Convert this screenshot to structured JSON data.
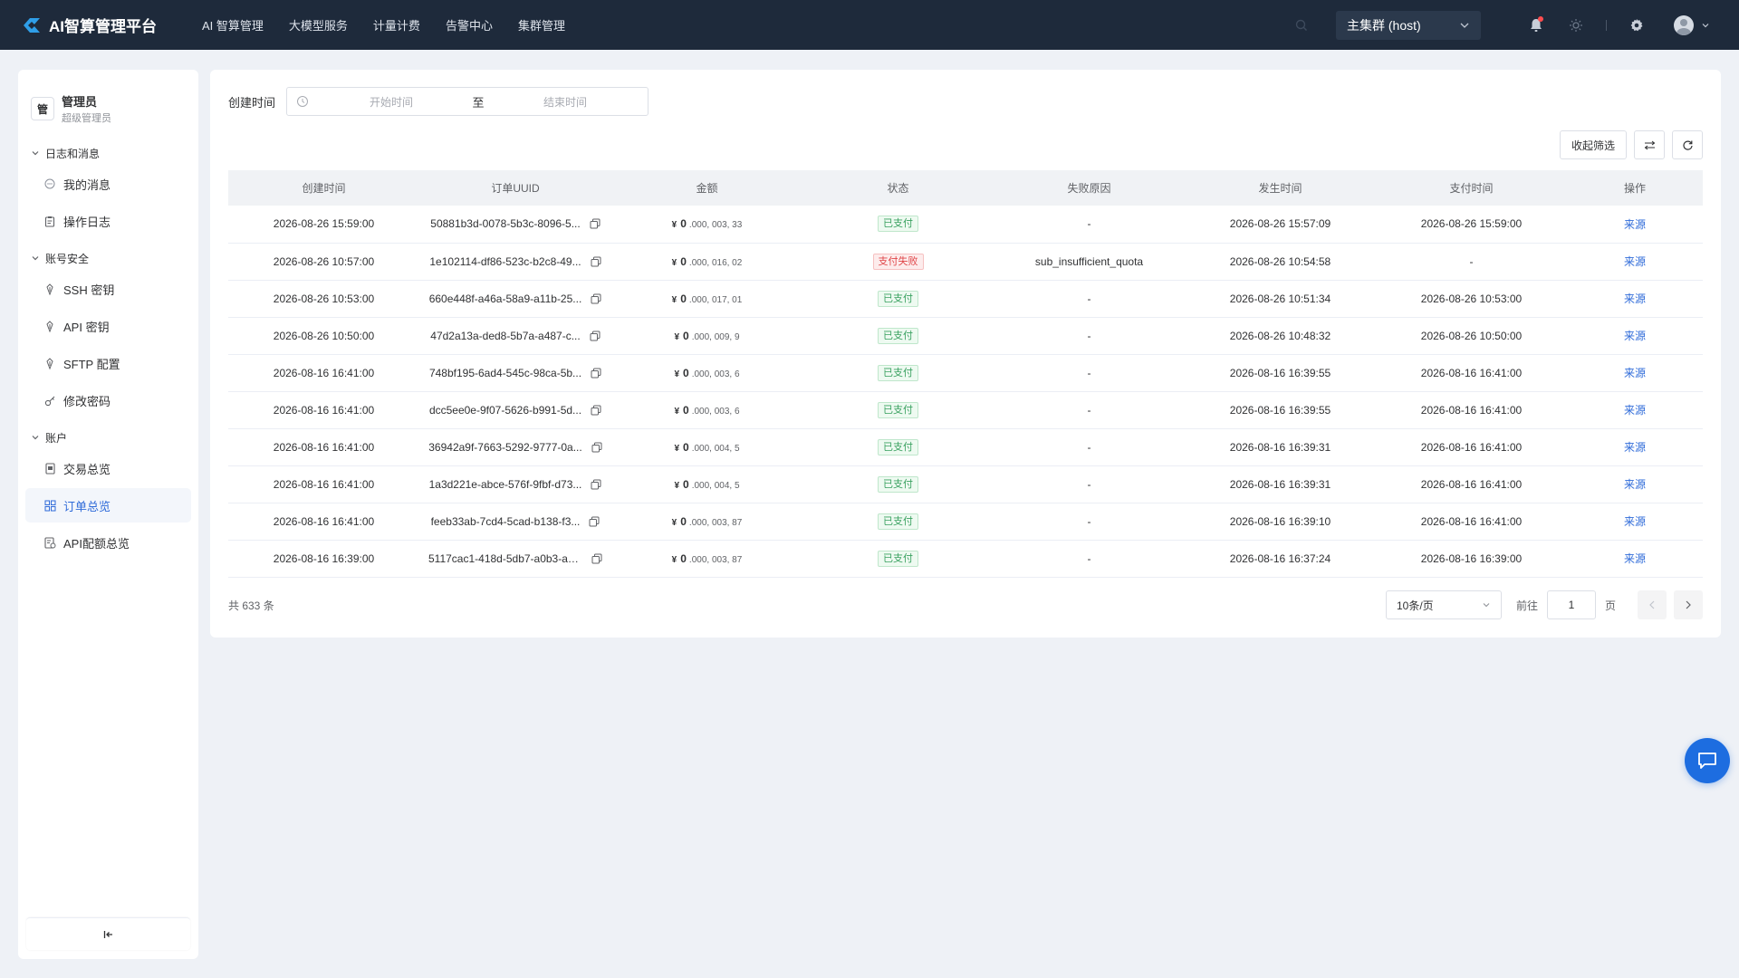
{
  "app": {
    "title": "AI智算管理平台",
    "brand_color": "#2f9ee8"
  },
  "nav": [
    {
      "label": "AI 智算管理"
    },
    {
      "label": "大模型服务"
    },
    {
      "label": "计量计费"
    },
    {
      "label": "告警中心"
    },
    {
      "label": "集群管理"
    }
  ],
  "header": {
    "cluster": "主集群 (host)"
  },
  "user": {
    "badge": "管",
    "name": "管理员",
    "role": "超级管理员"
  },
  "sidebar": {
    "groups": [
      {
        "title": "日志和消息",
        "items": [
          {
            "label": "我的消息",
            "icon": "message-icon"
          },
          {
            "label": "操作日志",
            "icon": "clipboard-icon"
          }
        ]
      },
      {
        "title": "账号安全",
        "items": [
          {
            "label": "SSH 密钥",
            "icon": "key-icon"
          },
          {
            "label": "API 密钥",
            "icon": "key-icon"
          },
          {
            "label": "SFTP 配置",
            "icon": "key-icon"
          },
          {
            "label": "修改密码",
            "icon": "password-icon"
          }
        ]
      },
      {
        "title": "账户",
        "items": [
          {
            "label": "交易总览",
            "icon": "receipt-icon"
          },
          {
            "label": "订单总览",
            "icon": "grid-icon",
            "active": true
          },
          {
            "label": "API配额总览",
            "icon": "quota-icon"
          }
        ]
      }
    ]
  },
  "filter": {
    "label": "创建时间",
    "start_placeholder": "开始时间",
    "separator": "至",
    "end_placeholder": "结束时间"
  },
  "tools": {
    "collapse_filter": "收起筛选"
  },
  "table": {
    "headers": [
      "创建时间",
      "订单UUID",
      "金额",
      "状态",
      "失败原因",
      "发生时间",
      "支付时间",
      "操作"
    ],
    "rows": [
      {
        "created": "2026-08-26 15:59:00",
        "uuid": "50881b3d-0078-5b3c-8096-5...",
        "currency": "¥",
        "amount_main": "0",
        "amount_frac": ".000, 003, 33",
        "status": "已支付",
        "status_type": "paid",
        "reason": "-",
        "occurred": "2026-08-26 15:57:09",
        "paid_at": "2026-08-26 15:59:00",
        "action": "来源"
      },
      {
        "created": "2026-08-26 10:57:00",
        "uuid": "1e102114-df86-523c-b2c8-49...",
        "currency": "¥",
        "amount_main": "0",
        "amount_frac": ".000, 016, 02",
        "status": "支付失败",
        "status_type": "failed",
        "reason": "sub_insufficient_quota",
        "occurred": "2026-08-26 10:54:58",
        "paid_at": "-",
        "action": "来源"
      },
      {
        "created": "2026-08-26 10:53:00",
        "uuid": "660e448f-a46a-58a9-a11b-25...",
        "currency": "¥",
        "amount_main": "0",
        "amount_frac": ".000, 017, 01",
        "status": "已支付",
        "status_type": "paid",
        "reason": "-",
        "occurred": "2026-08-26 10:51:34",
        "paid_at": "2026-08-26 10:53:00",
        "action": "来源"
      },
      {
        "created": "2026-08-26 10:50:00",
        "uuid": "47d2a13a-ded8-5b7a-a487-c...",
        "currency": "¥",
        "amount_main": "0",
        "amount_frac": ".000, 009, 9",
        "status": "已支付",
        "status_type": "paid",
        "reason": "-",
        "occurred": "2026-08-26 10:48:32",
        "paid_at": "2026-08-26 10:50:00",
        "action": "来源"
      },
      {
        "created": "2026-08-16 16:41:00",
        "uuid": "748bf195-6ad4-545c-98ca-5b...",
        "currency": "¥",
        "amount_main": "0",
        "amount_frac": ".000, 003, 6",
        "status": "已支付",
        "status_type": "paid",
        "reason": "-",
        "occurred": "2026-08-16 16:39:55",
        "paid_at": "2026-08-16 16:41:00",
        "action": "来源"
      },
      {
        "created": "2026-08-16 16:41:00",
        "uuid": "dcc5ee0e-9f07-5626-b991-5d...",
        "currency": "¥",
        "amount_main": "0",
        "amount_frac": ".000, 003, 6",
        "status": "已支付",
        "status_type": "paid",
        "reason": "-",
        "occurred": "2026-08-16 16:39:55",
        "paid_at": "2026-08-16 16:41:00",
        "action": "来源"
      },
      {
        "created": "2026-08-16 16:41:00",
        "uuid": "36942a9f-7663-5292-9777-0a...",
        "currency": "¥",
        "amount_main": "0",
        "amount_frac": ".000, 004, 5",
        "status": "已支付",
        "status_type": "paid",
        "reason": "-",
        "occurred": "2026-08-16 16:39:31",
        "paid_at": "2026-08-16 16:41:00",
        "action": "来源"
      },
      {
        "created": "2026-08-16 16:41:00",
        "uuid": "1a3d221e-abce-576f-9fbf-d73...",
        "currency": "¥",
        "amount_main": "0",
        "amount_frac": ".000, 004, 5",
        "status": "已支付",
        "status_type": "paid",
        "reason": "-",
        "occurred": "2026-08-16 16:39:31",
        "paid_at": "2026-08-16 16:41:00",
        "action": "来源"
      },
      {
        "created": "2026-08-16 16:41:00",
        "uuid": "feeb33ab-7cd4-5cad-b138-f3...",
        "currency": "¥",
        "amount_main": "0",
        "amount_frac": ".000, 003, 87",
        "status": "已支付",
        "status_type": "paid",
        "reason": "-",
        "occurred": "2026-08-16 16:39:10",
        "paid_at": "2026-08-16 16:41:00",
        "action": "来源"
      },
      {
        "created": "2026-08-16 16:39:00",
        "uuid": "5117cac1-418d-5db7-a0b3-a3...",
        "currency": "¥",
        "amount_main": "0",
        "amount_frac": ".000, 003, 87",
        "status": "已支付",
        "status_type": "paid",
        "reason": "-",
        "occurred": "2026-08-16 16:37:24",
        "paid_at": "2026-08-16 16:39:00",
        "action": "来源"
      }
    ]
  },
  "pagination": {
    "total_text": "共 633 条",
    "page_size": "10条/页",
    "goto_label": "前往",
    "current_page": "1",
    "page_unit": "页"
  },
  "colors": {
    "accent": "#2f6bd9",
    "topbar": "#1e2a3b",
    "paid": "#3aa160",
    "failed": "#e0474a"
  }
}
